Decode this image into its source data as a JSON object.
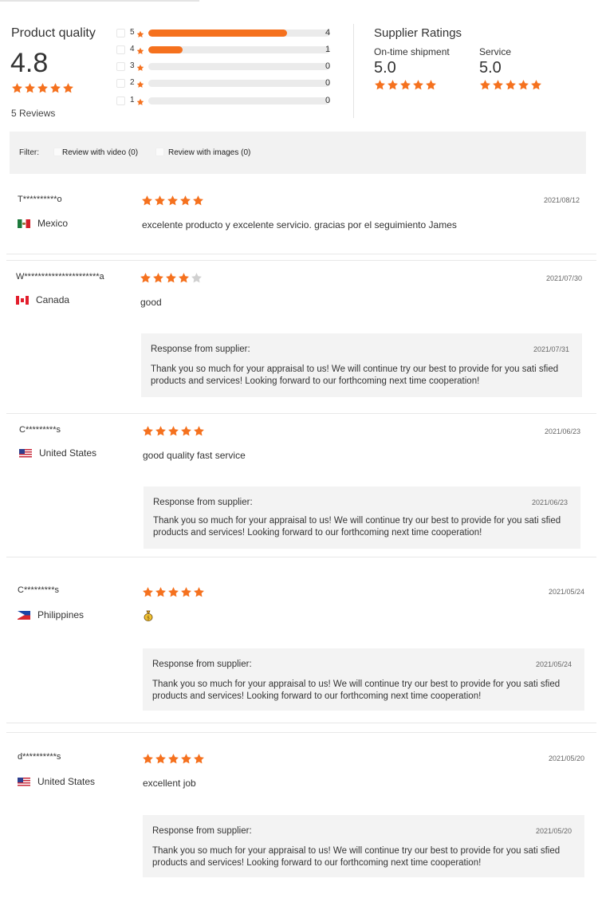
{
  "summary": {
    "product_quality": {
      "title": "Product quality",
      "score": "4.8",
      "stars": 5,
      "reviews_count": "5 Reviews"
    },
    "distribution": [
      {
        "label": "5",
        "count": "4",
        "fraction": 0.765
      },
      {
        "label": "4",
        "count": "1",
        "fraction": 0.19
      },
      {
        "label": "3",
        "count": "0",
        "fraction": 0
      },
      {
        "label": "2",
        "count": "0",
        "fraction": 0
      },
      {
        "label": "1",
        "count": "0",
        "fraction": 0
      }
    ],
    "supplier_ratings": {
      "title": "Supplier Ratings",
      "items": [
        {
          "label": "On-time shipment",
          "score": "5.0",
          "stars": 5
        },
        {
          "label": "Service",
          "score": "5.0",
          "stars": 5
        }
      ]
    }
  },
  "filter": {
    "label": "Filter:",
    "options": [
      "Review with video (0)",
      "Review with images (0)"
    ]
  },
  "reviews": [
    {
      "name": "T**********o",
      "country": "Mexico",
      "flag": "mx",
      "stars": 5,
      "date": "2021/08/12",
      "text": "excelente producto y excelente servicio. gracias por el seguimiento James",
      "response": null
    },
    {
      "name": "W**********************a",
      "country": "Canada",
      "flag": "ca",
      "stars": 4,
      "date": "2021/07/30",
      "text": "good",
      "response": {
        "title": "Response from supplier:",
        "date": "2021/07/31",
        "text": "Thank you so much for your appraisal to us! We will continue try our best to provide for you sati sfied products and services! Looking forward to our forthcoming next time cooperation!"
      }
    },
    {
      "name": "C*********s",
      "country": "United States",
      "flag": "us",
      "stars": 5,
      "date": "2021/06/23",
      "text": "good quality fast service",
      "response": {
        "title": "Response from supplier:",
        "date": "2021/06/23",
        "text": "Thank you so much for your appraisal to us! We will continue try our best to provide for you sati sfied products and services! Looking forward to our forthcoming next time cooperation!"
      }
    },
    {
      "name": "C*********s",
      "country": "Philippines",
      "flag": "ph",
      "stars": 5,
      "date": "2021/05/24",
      "text": "",
      "emoji": "money-bag-icon",
      "response": {
        "title": "Response from supplier:",
        "date": "2021/05/24",
        "text": "Thank you so much for your appraisal to us! We will continue try our best to provide for you sati sfied products and services! Looking forward to our forthcoming next time cooperation!"
      }
    },
    {
      "name": "d**********s",
      "country": "United States",
      "flag": "us",
      "stars": 5,
      "date": "2021/05/20",
      "text": "excellent job",
      "response": {
        "title": "Response from supplier:",
        "date": "2021/05/20",
        "text": "Thank you so much for your appraisal to us! We will continue try our best to provide for you sati sfied products and services! Looking forward to our forthcoming next time cooperation!"
      }
    }
  ],
  "colors": {
    "star_filled": "#f5711e",
    "star_empty": "#d0d0d0",
    "bar_fill": "#f5711e",
    "bar_track": "#ebebeb"
  }
}
